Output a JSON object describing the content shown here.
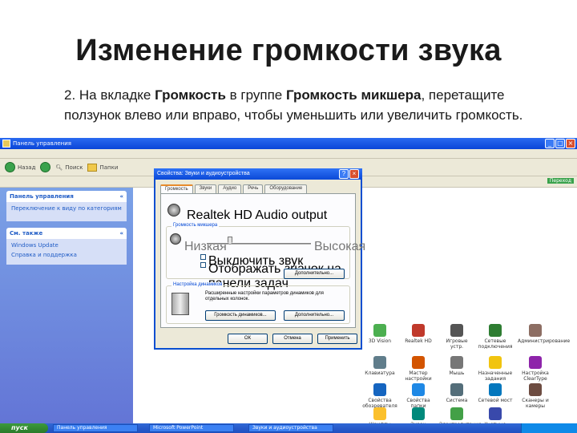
{
  "slide": {
    "title": "Изменение громкости звука",
    "instruction_prefix": "2. На вкладке ",
    "instruction_tab": "Громкость",
    "instruction_mid": " в группе ",
    "instruction_group": "Громкость микшера",
    "instruction_suffix": ", перетащите ползунок влево или вправо, чтобы уменьшить или увеличить громкость."
  },
  "window": {
    "title": "Панель управления",
    "go_label": "Переход"
  },
  "toolbar": {
    "back": "Назад",
    "search": "Поиск",
    "folders": "Папки"
  },
  "sidebar": {
    "panel1_title": "Панель управления",
    "panel1_link": "Переключение к виду по категориям",
    "panel2_title": "См. также",
    "panel2_links": [
      "Windows Update",
      "Справка и поддержка"
    ]
  },
  "dialog": {
    "title": "Свойства: Звуки и аудиоустройства",
    "tabs": [
      "Громкость",
      "Звуки",
      "Аудио",
      "Речь",
      "Оборудование"
    ],
    "device": "Realtek HD Audio output",
    "mixer_group": "Громкость микшера",
    "low": "Низкая",
    "high": "Высокая",
    "mute": "Выключить звук",
    "tray_icon": "Отображать значок на панели задач",
    "advanced": "Дополнительно...",
    "speaker_group": "Настройка динамиков",
    "speaker_text": "Расширенные настройки параметров динамиков для отдельных колонок.",
    "speaker_volume": "Громкость динамиков...",
    "advanced2": "Дополнительно...",
    "ok": "ОК",
    "cancel": "Отмена",
    "apply": "Применить"
  },
  "icons": [
    {
      "label": "3D Vision",
      "color": "#4caf50"
    },
    {
      "label": "Realtek HD",
      "color": "#c0392b"
    },
    {
      "label": "Игровые устр.",
      "color": "#555"
    },
    {
      "label": "Сетевые подключения",
      "color": "#2e7d32"
    },
    {
      "label": "Администрирование",
      "color": "#8d6e63"
    },
    {
      "label": "Клавиатура",
      "color": "#607d8b"
    },
    {
      "label": "Мастер настройки",
      "color": "#d35400"
    },
    {
      "label": "Мышь",
      "color": "#777"
    },
    {
      "label": "Назначенные задания",
      "color": "#f1c40f"
    },
    {
      "label": "Настройка ClearType",
      "color": "#8e24aa"
    },
    {
      "label": "Свойства обозревателя",
      "color": "#1565c0"
    },
    {
      "label": "Свойства папки",
      "color": "#1e88e5"
    },
    {
      "label": "Система",
      "color": "#546e7a"
    },
    {
      "label": "Сетевой мост",
      "color": "#0277bd"
    },
    {
      "label": "Сканеры и камеры",
      "color": "#6d4c41"
    },
    {
      "label": "Шрифты",
      "color": "#fbc02d"
    },
    {
      "label": "Экран",
      "color": "#00897b"
    },
    {
      "label": "Электропитание",
      "color": "#43a047"
    },
    {
      "label": "Учетные записи",
      "color": "#3949ab"
    }
  ],
  "taskbar": {
    "start": "пуск",
    "tasks": [
      "Панель управления",
      "Microsoft PowerPoint",
      "Звуки и аудиоустройства"
    ]
  }
}
